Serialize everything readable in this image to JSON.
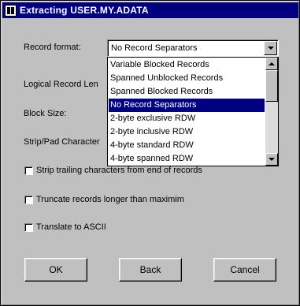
{
  "window": {
    "title": "Extracting USER.MY.ADATA"
  },
  "form": {
    "record_format_label": "Record format:",
    "logical_record_label": "Logical Record Len",
    "block_size_label": "Block Size:",
    "strip_pad_label": "Strip/Pad Character"
  },
  "record_format": {
    "value": "No Record Separators",
    "options": [
      "Variable Blocked Records",
      "Spanned Unblocked Records",
      "Spanned Blocked Records",
      "No Record Separators",
      "2-byte exclusive RDW",
      "2-byte inclusive RDW",
      "4-byte standard RDW",
      "4-byte spanned RDW"
    ],
    "selected_index": 3
  },
  "checkboxes": [
    {
      "label": "Strip trailing characters from end of records",
      "checked": false
    },
    {
      "label": "Truncate records longer than maximim",
      "checked": false
    },
    {
      "label": "Translate to ASCII",
      "checked": false
    }
  ],
  "buttons": {
    "ok": "OK",
    "back": "Back",
    "cancel": "Cancel"
  },
  "colors": {
    "title_bar": "#000080",
    "selection": "#000080",
    "face": "#c0c0c0"
  }
}
